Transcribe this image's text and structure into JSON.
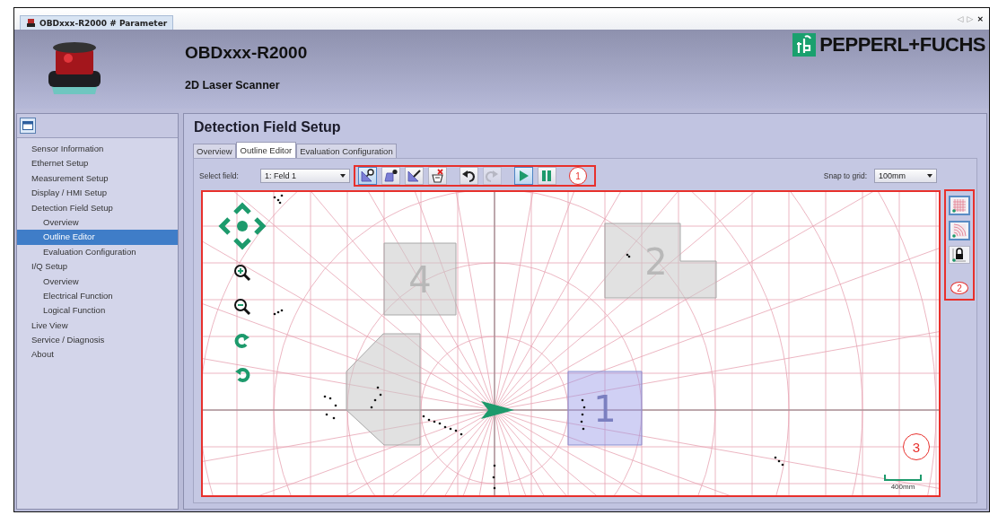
{
  "window": {
    "tab_title": "OBDxxx-R2000 # Parameter",
    "nav_buttons": [
      "◁",
      "▷",
      "×"
    ]
  },
  "header": {
    "title": "OBDxxx-R2000",
    "subtitle": "2D Laser Scanner",
    "logo_text": "PEPPERL+FUCHS"
  },
  "sidebar": {
    "items": [
      {
        "label": "Sensor Information",
        "selected": false
      },
      {
        "label": "Ethernet Setup",
        "selected": false
      },
      {
        "label": "Measurement Setup",
        "selected": false
      },
      {
        "label": "Display / HMI Setup",
        "selected": false
      },
      {
        "label": "Detection Field Setup",
        "selected": false,
        "children": [
          {
            "label": "Overview",
            "selected": false
          },
          {
            "label": "Outline Editor",
            "selected": true
          },
          {
            "label": "Evaluation Configuration",
            "selected": false
          }
        ]
      },
      {
        "label": "I/Q Setup",
        "selected": false,
        "children": [
          {
            "label": "Overview",
            "selected": false
          },
          {
            "label": "Electrical Function",
            "selected": false
          },
          {
            "label": "Logical Function",
            "selected": false
          }
        ]
      },
      {
        "label": "Live View",
        "selected": false
      },
      {
        "label": "Service / Diagnosis",
        "selected": false
      },
      {
        "label": "About",
        "selected": false
      }
    ]
  },
  "main": {
    "title": "Detection Field Setup",
    "tabs": [
      {
        "label": "Overview",
        "selected": false
      },
      {
        "label": "Outline Editor",
        "selected": true
      },
      {
        "label": "Evaluation Configuration",
        "selected": false
      }
    ],
    "select_field": {
      "label": "Select field:",
      "value": "1: Feld 1"
    },
    "toolbar": {
      "callout": "1",
      "groups": [
        [
          {
            "kind": "zoom",
            "pressed": true,
            "disabled": false
          },
          {
            "kind": "addpoint",
            "pressed": false,
            "disabled": false
          },
          {
            "kind": "draw",
            "pressed": false,
            "disabled": false
          },
          {
            "kind": "delete",
            "pressed": false,
            "disabled": false
          }
        ],
        [
          {
            "kind": "undo",
            "pressed": false,
            "disabled": false
          },
          {
            "kind": "redo",
            "pressed": false,
            "disabled": true
          }
        ],
        [
          {
            "kind": "play",
            "pressed": true,
            "disabled": false
          },
          {
            "kind": "pause",
            "pressed": false,
            "disabled": false
          }
        ]
      ]
    },
    "snap_to_grid": {
      "label": "Snap to grid:",
      "value": "100mm"
    },
    "side_tools": {
      "callout": "2",
      "buttons": [
        {
          "kind": "grid",
          "pressed": true
        },
        {
          "kind": "polar",
          "pressed": true
        },
        {
          "kind": "lock",
          "pressed": false
        }
      ]
    },
    "canvas": {
      "callout": "3",
      "scale_label": "400mm",
      "fields": [
        {
          "kind": "rect",
          "label": "4",
          "selected": false
        },
        {
          "kind": "lshape",
          "label": "2",
          "selected": false
        },
        {
          "kind": "octagon",
          "selected": false
        },
        {
          "kind": "square",
          "label": "1",
          "selected": true
        }
      ]
    }
  }
}
